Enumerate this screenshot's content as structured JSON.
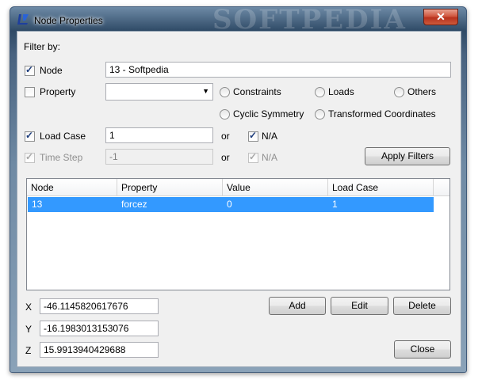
{
  "window": {
    "title": "Node Properties",
    "watermark": "SOFTPEDIA",
    "close_glyph": "✕"
  },
  "filter": {
    "heading": "Filter by:",
    "node": {
      "label": "Node",
      "checked": true,
      "value": "13 - Softpedia"
    },
    "property": {
      "label": "Property",
      "checked": false,
      "value": ""
    },
    "radios": {
      "constraints": "Constraints",
      "loads": "Loads",
      "others": "Others",
      "cyclic_symmetry": "Cyclic Symmetry",
      "transformed_coordinates": "Transformed Coordinates"
    },
    "load_case": {
      "label": "Load Case",
      "checked": true,
      "value": "1",
      "or": "or",
      "na_label": "N/A",
      "na_checked": true
    },
    "time_step": {
      "label": "Time Step",
      "checked": true,
      "disabled": true,
      "value": "-1",
      "or": "or",
      "na_label": "N/A",
      "na_checked": true
    },
    "apply_label": "Apply Filters"
  },
  "table": {
    "columns": [
      "Node",
      "Property",
      "Value",
      "Load Case"
    ],
    "rows": [
      {
        "node": "13",
        "property": "forcez",
        "value": "0",
        "load_case": "1"
      }
    ]
  },
  "coords": {
    "x_label": "X",
    "x_value": "-46.1145820617676",
    "y_label": "Y",
    "y_value": "-16.1983013153076",
    "z_label": "Z",
    "z_value": "15.9913940429688"
  },
  "buttons": {
    "add": "Add",
    "edit": "Edit",
    "delete": "Delete",
    "close": "Close"
  },
  "colors": {
    "selection": "#3399ff",
    "close_button": "#c8412a"
  },
  "icons": {
    "app": "ansys-logo-icon",
    "dropdown": "chevron-down-icon",
    "close": "close-icon"
  }
}
